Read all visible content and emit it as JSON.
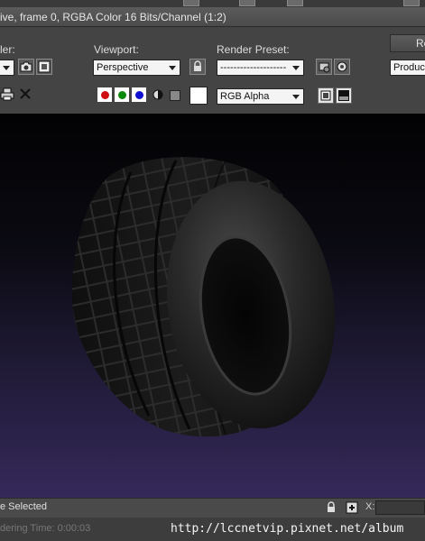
{
  "window": {
    "title": "ive, frame 0, RGBA Color 16 Bits/Channel (1:2)"
  },
  "toolbar": {
    "area_label": "ler:",
    "viewport_label": "Viewport:",
    "viewport_value": "Perspective",
    "render_preset_label": "Render Preset:",
    "render_preset_value": "--------------------",
    "render_button_label": "Re",
    "production_value": "Productio",
    "channel_value": "RGB Alpha",
    "channels": [
      {
        "name": "red-channel",
        "color": "#d01010"
      },
      {
        "name": "green-channel",
        "color": "#0a8a0a"
      },
      {
        "name": "blue-channel",
        "color": "#1010d0"
      }
    ],
    "icons": [
      "camera-icon",
      "frame-icon",
      "lock-icon",
      "render-setup-icon",
      "render-icon",
      "print-icon",
      "close-icon",
      "mono-icon",
      "gray-square-icon",
      "display-alpha-icon",
      "toggle-ui-icon"
    ]
  },
  "viewport": {
    "subject": "tire",
    "background_top": "#020203",
    "background_bottom": "#35295a"
  },
  "status": {
    "selection_text": "e Selected",
    "x_label": "X:",
    "rendering_time_text": "dering Time: 0:00:03",
    "watermark_url": "http://lccnetvip.pixnet.net/album"
  }
}
